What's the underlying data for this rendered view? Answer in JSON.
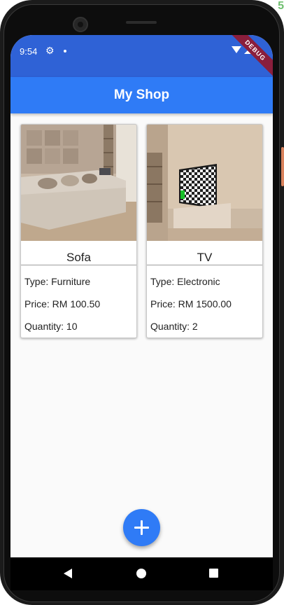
{
  "status_bar": {
    "time": "9:54",
    "icons": [
      "gear-icon",
      "notification-dot-icon",
      "wifi-icon",
      "signal-icon"
    ],
    "color": "#2f62d6"
  },
  "debug_banner": "DEBUG",
  "app_bar": {
    "title": "My Shop",
    "color": "#2f7bf6"
  },
  "products": [
    {
      "name": "Sofa",
      "type": "Type: Furniture",
      "price": "Price: RM 100.50",
      "quantity": "Quantity: 10",
      "image": "sofa-photo"
    },
    {
      "name": "TV",
      "type": "Type: Electronic",
      "price": "Price: RM 1500.00",
      "quantity": "Quantity: 2",
      "image": "tv-photo"
    }
  ],
  "fab": {
    "icon": "plus-icon",
    "color": "#2f7bf6"
  },
  "nav_bar": {
    "icons": [
      "back-icon",
      "home-icon",
      "recents-icon"
    ]
  }
}
